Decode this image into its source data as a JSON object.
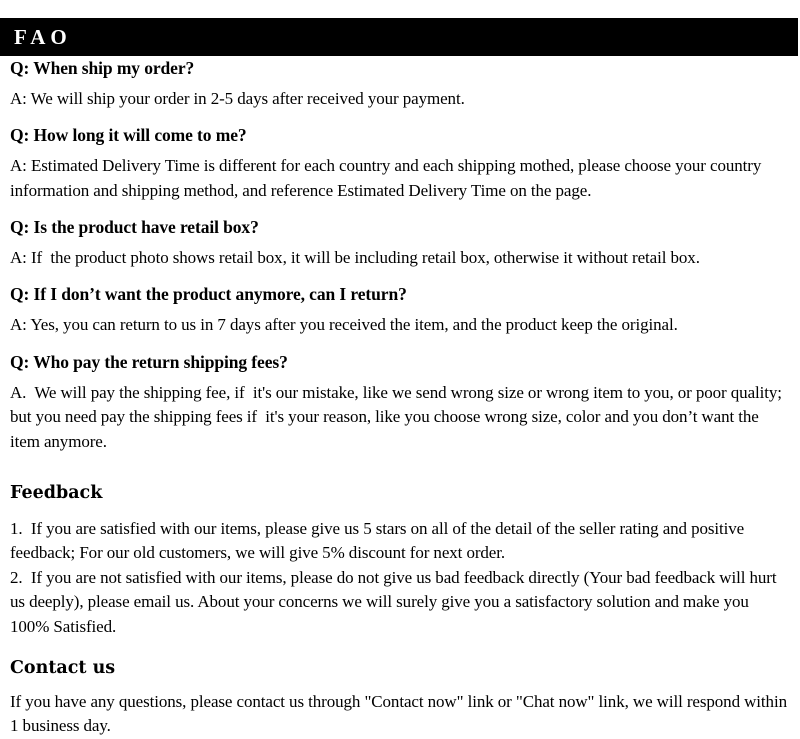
{
  "header": {
    "title": "FAO",
    "background_color": "#000000",
    "text_color": "#ffffff"
  },
  "faq": {
    "items": [
      {
        "question": "Q: When ship my order?",
        "answer": "A: We will ship your order in 2-5 days after received your payment."
      },
      {
        "question": "Q: How long it will come to me?",
        "answer": "A: Estimated Delivery Time is different for each country and each shipping mothed, please choose your country information and shipping method, and reference Estimated Delivery Time on the page."
      },
      {
        "question": "Q: Is the product have retail box?",
        "answer": "A: If  the product photo shows retail box, it will be including retail box, otherwise it without retail box."
      },
      {
        "question": "Q: If I don’t want the product anymore, can I return?",
        "answer": "A: Yes, you can return to us in 7 days after you received the item, and the product keep the original."
      },
      {
        "question": "Q: Who pay the return shipping fees?",
        "answer": "A.  We will pay the shipping fee, if  it's our mistake, like we send wrong size or wrong item to you, or poor quality; but you need pay the shipping fees if  it's your reason, like you choose wrong size, color and you don’t want the item anymore."
      }
    ]
  },
  "feedback": {
    "heading": "Feedback",
    "item_1": "1.  If you are satisfied with our items, please give us 5 stars on all of the detail of the seller rating and positive feedback; For our old customers, we will give 5% discount for next order.",
    "item_2": "2.  If you are not satisfied with our items, please do not give us bad feedback directly (Your bad feedback will hurt us deeply), please email us. About your concerns we will surely give you a satisfactory solution and make you 100% Satisfied."
  },
  "contact": {
    "heading": "Contact us",
    "body": "If you have any questions, please contact us through \"Contact now\" link or \"Chat now\" link, we will respond within 1 business day."
  }
}
